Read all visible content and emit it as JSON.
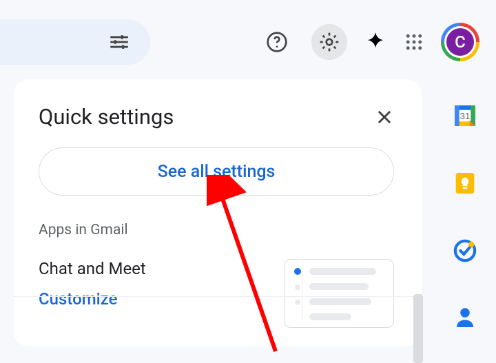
{
  "header": {
    "avatar_initial": "C"
  },
  "panel": {
    "title": "Quick settings",
    "see_all_label": "See all settings",
    "section_label": "Apps in Gmail",
    "chat_meet_label": "Chat and Meet",
    "customize_label": "Customize"
  },
  "rail": {
    "calendar_day": "31"
  }
}
